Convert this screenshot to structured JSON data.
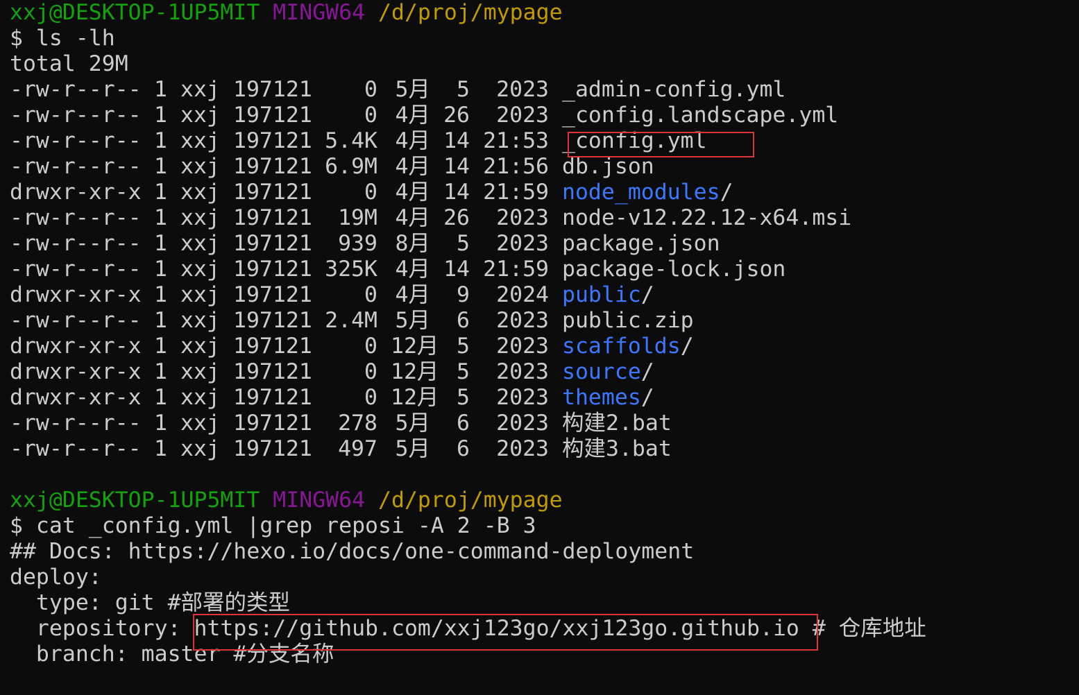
{
  "prompt1": {
    "user_host": "xxj@DESKTOP-1UP5MIT",
    "shell": "MINGW64",
    "cwd": "/d/proj/mypage"
  },
  "command1": "$ ls -lh",
  "total": "total 29M",
  "files": [
    {
      "perm": "-rw-r--r--",
      "links": "1",
      "owner": "xxj",
      "group": "197121",
      "size": "0",
      "month": "5月",
      "day": "5",
      "time": "2023",
      "name": "_admin-config.yml",
      "suffix": "",
      "is_dir": false
    },
    {
      "perm": "-rw-r--r--",
      "links": "1",
      "owner": "xxj",
      "group": "197121",
      "size": "0",
      "month": "4月",
      "day": "26",
      "time": "2023",
      "name": "_config.landscape.yml",
      "suffix": "",
      "is_dir": false
    },
    {
      "perm": "-rw-r--r--",
      "links": "1",
      "owner": "xxj",
      "group": "197121",
      "size": "5.4K",
      "month": "4月",
      "day": "14",
      "time": "21:53",
      "name": "_config.yml",
      "suffix": "",
      "is_dir": false
    },
    {
      "perm": "-rw-r--r--",
      "links": "1",
      "owner": "xxj",
      "group": "197121",
      "size": "6.9M",
      "month": "4月",
      "day": "14",
      "time": "21:56",
      "name": "db.json",
      "suffix": "",
      "is_dir": false
    },
    {
      "perm": "drwxr-xr-x",
      "links": "1",
      "owner": "xxj",
      "group": "197121",
      "size": "0",
      "month": "4月",
      "day": "14",
      "time": "21:59",
      "name": "node_modules",
      "suffix": "/",
      "is_dir": true
    },
    {
      "perm": "-rw-r--r--",
      "links": "1",
      "owner": "xxj",
      "group": "197121",
      "size": "19M",
      "month": "4月",
      "day": "26",
      "time": "2023",
      "name": "node-v12.22.12-x64.msi",
      "suffix": "",
      "is_dir": false
    },
    {
      "perm": "-rw-r--r--",
      "links": "1",
      "owner": "xxj",
      "group": "197121",
      "size": "939",
      "month": "8月",
      "day": "5",
      "time": "2023",
      "name": "package.json",
      "suffix": "",
      "is_dir": false
    },
    {
      "perm": "-rw-r--r--",
      "links": "1",
      "owner": "xxj",
      "group": "197121",
      "size": "325K",
      "month": "4月",
      "day": "14",
      "time": "21:59",
      "name": "package-lock.json",
      "suffix": "",
      "is_dir": false
    },
    {
      "perm": "drwxr-xr-x",
      "links": "1",
      "owner": "xxj",
      "group": "197121",
      "size": "0",
      "month": "4月",
      "day": "9",
      "time": "2024",
      "name": "public",
      "suffix": "/",
      "is_dir": true
    },
    {
      "perm": "-rw-r--r--",
      "links": "1",
      "owner": "xxj",
      "group": "197121",
      "size": "2.4M",
      "month": "5月",
      "day": "6",
      "time": "2023",
      "name": "public.zip",
      "suffix": "",
      "is_dir": false
    },
    {
      "perm": "drwxr-xr-x",
      "links": "1",
      "owner": "xxj",
      "group": "197121",
      "size": "0",
      "month": "12月",
      "day": "5",
      "time": "2023",
      "name": "scaffolds",
      "suffix": "/",
      "is_dir": true
    },
    {
      "perm": "drwxr-xr-x",
      "links": "1",
      "owner": "xxj",
      "group": "197121",
      "size": "0",
      "month": "12月",
      "day": "5",
      "time": "2023",
      "name": "source",
      "suffix": "/",
      "is_dir": true
    },
    {
      "perm": "drwxr-xr-x",
      "links": "1",
      "owner": "xxj",
      "group": "197121",
      "size": "0",
      "month": "12月",
      "day": "5",
      "time": "2023",
      "name": "themes",
      "suffix": "/",
      "is_dir": true
    },
    {
      "perm": "-rw-r--r--",
      "links": "1",
      "owner": "xxj",
      "group": "197121",
      "size": "278",
      "month": "5月",
      "day": "6",
      "time": "2023",
      "name": "构建2.bat",
      "suffix": "",
      "is_dir": false
    },
    {
      "perm": "-rw-r--r--",
      "links": "1",
      "owner": "xxj",
      "group": "197121",
      "size": "497",
      "month": "5月",
      "day": "6",
      "time": "2023",
      "name": "构建3.bat",
      "suffix": "",
      "is_dir": false
    }
  ],
  "prompt2": {
    "user_host": "xxj@DESKTOP-1UP5MIT",
    "shell": "MINGW64",
    "cwd": "/d/proj/mypage"
  },
  "command2": "$ cat _config.yml |grep reposi -A 2 -B 3",
  "output2": [
    "## Docs: https://hexo.io/docs/one-command-deployment",
    "deploy:",
    "  type: git #部署的类型",
    "  repository: https://github.com/xxj123go/xxj123go.github.io # 仓库地址",
    "  branch: master #分支名称"
  ],
  "colors": {
    "background": "#0c0c0c",
    "text": "#cccccc",
    "user_host": "#13a10e",
    "shell": "#881798",
    "cwd": "#c19c00",
    "directory": "#3b78ff",
    "highlight_box": "#e0343b"
  }
}
